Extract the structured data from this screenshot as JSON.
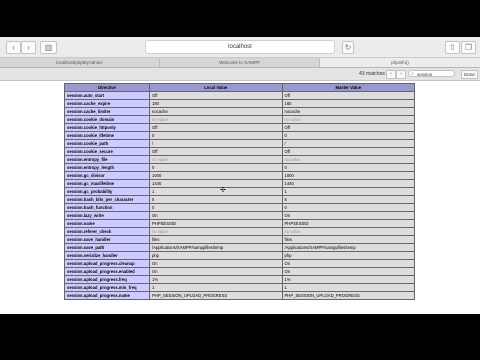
{
  "browser": {
    "address": "localhost",
    "tabs": [
      {
        "label": "localhost/phpMyAdmin/"
      },
      {
        "label": "Welcome to XAMPP"
      },
      {
        "label": "phpinfo()",
        "active": true
      }
    ]
  },
  "findbar": {
    "count": "43 matches",
    "query": "session",
    "done_label": "Done"
  },
  "table": {
    "headers": [
      "Directive",
      "Local Value",
      "Master Value"
    ],
    "rows": [
      {
        "directive": "session.auto_start",
        "local": "Off",
        "master": "Off"
      },
      {
        "directive": "session.cache_expire",
        "local": "180",
        "master": "180"
      },
      {
        "directive": "session.cache_limiter",
        "local": "nocache",
        "master": "nocache"
      },
      {
        "directive": "session.cookie_domain",
        "local": "no value",
        "master": "no value",
        "novalue": true
      },
      {
        "directive": "session.cookie_httponly",
        "local": "Off",
        "master": "Off"
      },
      {
        "directive": "session.cookie_lifetime",
        "local": "0",
        "master": "0"
      },
      {
        "directive": "session.cookie_path",
        "local": "/",
        "master": "/"
      },
      {
        "directive": "session.cookie_secure",
        "local": "Off",
        "master": "Off"
      },
      {
        "directive": "session.entropy_file",
        "local": "no value",
        "master": "no value",
        "novalue": true
      },
      {
        "directive": "session.entropy_length",
        "local": "0",
        "master": "0"
      },
      {
        "directive": "session.gc_divisor",
        "local": "1000",
        "master": "1000"
      },
      {
        "directive": "session.gc_maxlifetime",
        "local": "1440",
        "master": "1440"
      },
      {
        "directive": "session.gc_probability",
        "local": "1",
        "master": "1"
      },
      {
        "directive": "session.hash_bits_per_character",
        "local": "5",
        "master": "5"
      },
      {
        "directive": "session.hash_function",
        "local": "0",
        "master": "0"
      },
      {
        "directive": "session.lazy_write",
        "local": "On",
        "master": "On"
      },
      {
        "directive": "session.name",
        "local": "PHPSESSID",
        "master": "PHPSESSID"
      },
      {
        "directive": "session.referer_check",
        "local": "no value",
        "master": "no value",
        "novalue": true
      },
      {
        "directive": "session.save_handler",
        "local": "files",
        "master": "files"
      },
      {
        "directive": "session.save_path",
        "local": "/Applications/XAMPP/xamppfiles/temp",
        "master": "/Applications/XAMPP/xamppfiles/temp"
      },
      {
        "directive": "session.serialize_handler",
        "local": "php",
        "master": "php"
      },
      {
        "directive": "session.upload_progress.cleanup",
        "local": "On",
        "master": "On"
      },
      {
        "directive": "session.upload_progress.enabled",
        "local": "On",
        "master": "On"
      },
      {
        "directive": "session.upload_progress.freq",
        "local": "1%",
        "master": "1%"
      },
      {
        "directive": "session.upload_progress.min_freq",
        "local": "1",
        "master": "1"
      },
      {
        "directive": "session.upload_progress.name",
        "local": "PHP_SESSION_UPLOAD_PROGRESS",
        "master": "PHP_SESSION_UPLOAD_PROGRESS"
      }
    ]
  }
}
